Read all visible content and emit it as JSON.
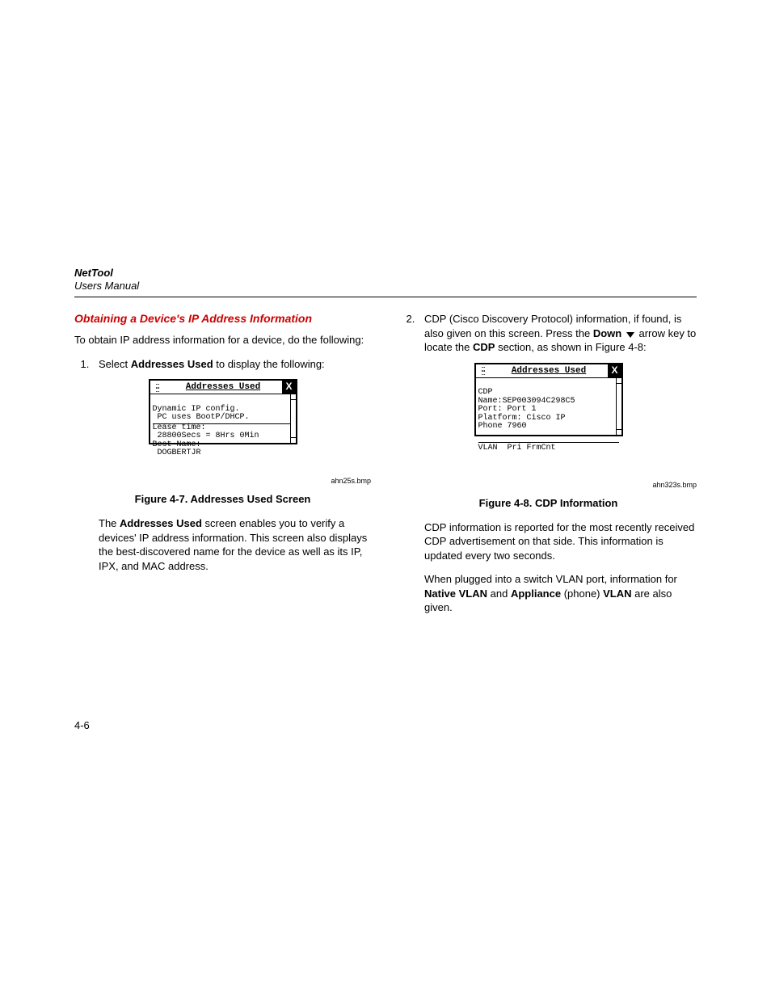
{
  "header": {
    "product": "NetTool",
    "doc_type": "Users Manual"
  },
  "left": {
    "heading": "Obtaining a Device's IP Address Information",
    "intro": "To obtain IP address information for a device, do the following:",
    "step1_pre": "Select ",
    "step1_bold": "Addresses Used",
    "step1_post": " to display the following:",
    "fig7_bmp": "ahn25s.bmp",
    "fig7_caption": "Figure 4-7. Addresses Used Screen",
    "para1_pre": "The ",
    "para1_bold": "Addresses Used",
    "para1_post": " screen enables you to verify a devices' IP address information. This screen also displays the best-discovered name for the device as well as its IP, IPX, and MAC address.",
    "device1": {
      "title": "Addresses Used",
      "line1": "Dynamic IP config.",
      "line2": " PC uses BootP/DHCP.",
      "line3": "Lease time:",
      "line4": " 28800Secs = 8Hrs 0Min",
      "line5": "Best Name:",
      "line6": " DOGBERTJR"
    }
  },
  "right": {
    "step2_pre": "CDP (Cisco Discovery Protocol) information, if found, is also given on this screen. Press the ",
    "step2_bold": "Down",
    "step2_mid": " ",
    "step2_post": " arrow key to locate the ",
    "step2_bold2": "CDP",
    "step2_end": " section, as shown in Figure 4-8:",
    "fig8_bmp": "ahn323s.bmp",
    "fig8_caption": "Figure 4-8. CDP Information",
    "para2": "CDP information is reported for the most recently received CDP advertisement on that side. This information is updated every two seconds.",
    "para3_pre": "When plugged into a switch VLAN port, information for ",
    "para3_b1": "Native VLAN",
    "para3_mid": " and ",
    "para3_b2": "Appliance",
    "para3_paren": " (phone) ",
    "para3_b3": "VLAN",
    "para3_end": " are also given.",
    "device2": {
      "title": "Addresses Used",
      "line1": "CDP",
      "line2": "Name:SEP003094C298C5",
      "line3": "Port: Port 1",
      "line4": "Platform: Cisco IP",
      "line5": "Phone 7960",
      "line6": "VLAN  Pri FrmCnt"
    }
  },
  "page_number": "4-6"
}
